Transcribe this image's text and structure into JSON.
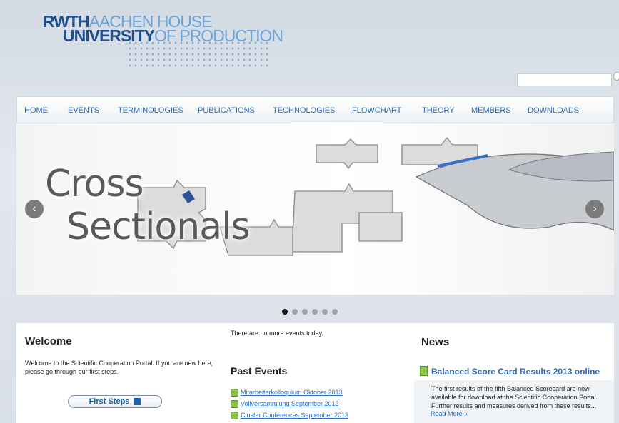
{
  "header": {
    "logo": {
      "line1_strong": "RWTH",
      "line1_light": "AACHEN HOUSE",
      "line2_strong": "UNIVERSITY",
      "line2_light": "OF PRODUCTION"
    },
    "search": {
      "value": "",
      "placeholder": ""
    }
  },
  "nav": [
    "HOME",
    "EVENTS",
    "TERMINOLOGIES",
    "PUBLICATIONS",
    "TECHNOLOGIES",
    "FLOWCHART",
    "THEORY",
    "MEMBERS",
    "DOWNLOADS"
  ],
  "slider": {
    "title_line1": "Cross",
    "title_line2": "Sectionals",
    "prev_label": "‹",
    "next_label": "›",
    "dot_count": 6,
    "active_dot_index": 0
  },
  "welcome": {
    "title": "Welcome",
    "text_line1": "Welcome to the Scientific Cooperation Portal. If you are new here,",
    "text_line2": "please go through our first steps.",
    "button_label": "First Steps"
  },
  "events": {
    "status": "There are no more events today.",
    "past_title": "Past Events",
    "items": [
      "Mitarbeiterkolloquium Oktober 2013",
      "Vollversammlung September 2013",
      "Cluster Conferences September 2013"
    ]
  },
  "news": {
    "title": "News",
    "headline": "Balanced Score Card Results 2013 online",
    "body_line1": "The first results of the fifth Balanced Scorecard are now",
    "body_line2": "available for download at the Scientific Cooperation Portal.",
    "body_line3": "Further results and measures derived from these results...",
    "read_more": "Read More »"
  },
  "colors": {
    "nav_text": "#2d6bb6",
    "logo_dark": "#1f4f8f",
    "logo_light": "#6aa4da"
  }
}
